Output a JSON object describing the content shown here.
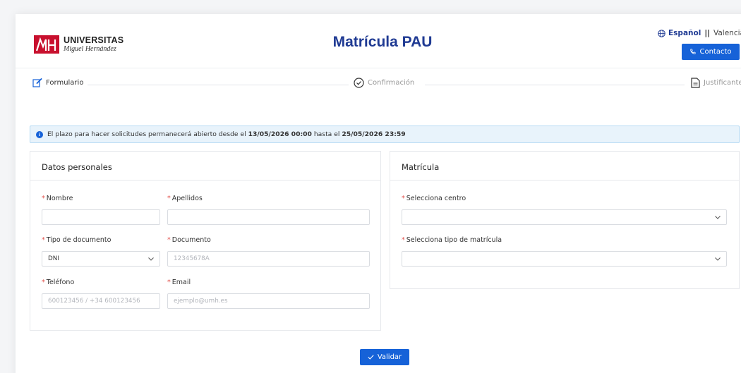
{
  "header": {
    "logo_line1": "UNIVERSITAS",
    "logo_line2": "Miguel Hernández",
    "title": "Matrícula PAU",
    "lang_active": "Español",
    "lang_separator": "||",
    "lang_other": "Valencià",
    "contact_label": "Contacto"
  },
  "steps": [
    {
      "label": "Formulario",
      "icon": "edit-icon"
    },
    {
      "label": "Confirmación",
      "icon": "check-circle-icon"
    },
    {
      "label": "Justificante",
      "icon": "document-icon"
    }
  ],
  "info": {
    "text_before": "El plazo para hacer solicitudes permanecerá abierto desde el",
    "start": "13/05/2026 00:00",
    "text_mid": "hasta el",
    "end": "25/05/2026 23:59"
  },
  "personal": {
    "title": "Datos personales",
    "required_mark": "*",
    "nombre": {
      "label": "Nombre",
      "value": ""
    },
    "apellidos": {
      "label": "Apellidos",
      "value": ""
    },
    "tipo_documento": {
      "label": "Tipo de documento",
      "value": "DNI"
    },
    "documento": {
      "label": "Documento",
      "placeholder": "12345678A"
    },
    "telefono": {
      "label": "Teléfono",
      "placeholder": "600123456 / +34 600123456"
    },
    "email": {
      "label": "Email",
      "placeholder": "ejemplo@umh.es"
    }
  },
  "matricula": {
    "title": "Matrícula",
    "centro": {
      "label": "Selecciona centro",
      "value": ""
    },
    "tipo": {
      "label": "Selecciona tipo de matrícula",
      "value": ""
    }
  },
  "actions": {
    "validate_label": "Validar"
  },
  "colors": {
    "brand_blue": "#1f3a93",
    "button_blue": "#1662d8",
    "required_red": "#e2504a",
    "logo_red": "#c8102e",
    "info_bg": "#e8f3fb"
  }
}
